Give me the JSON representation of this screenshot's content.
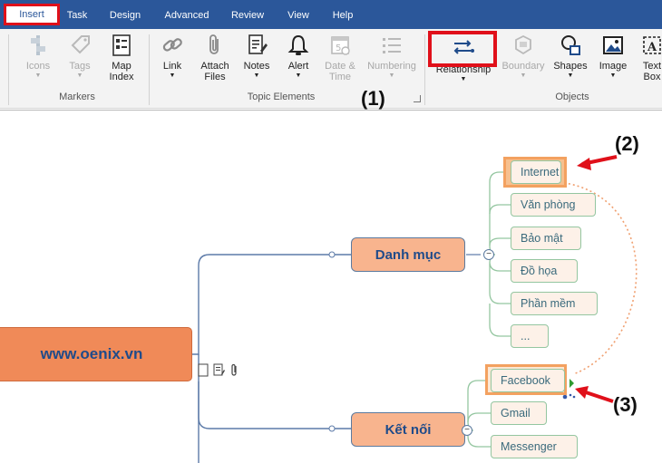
{
  "tabs": [
    {
      "label": "Insert",
      "active": true
    },
    {
      "label": "Task"
    },
    {
      "label": "Design"
    },
    {
      "label": "Advanced"
    },
    {
      "label": "Review"
    },
    {
      "label": "View"
    },
    {
      "label": "Help"
    }
  ],
  "ribbon": {
    "markers": {
      "label": "Markers",
      "buttons": [
        {
          "label": "Icons",
          "icon": "icons-icon",
          "enabled": false
        },
        {
          "label": "Tags",
          "icon": "tag-icon",
          "enabled": false
        },
        {
          "label": "Map\nIndex",
          "icon": "map-index-icon",
          "enabled": true
        }
      ]
    },
    "topic_elements": {
      "label": "Topic Elements",
      "buttons": [
        {
          "label": "Link",
          "icon": "link-icon",
          "enabled": true
        },
        {
          "label": "Attach\nFiles",
          "icon": "paperclip-icon",
          "enabled": true
        },
        {
          "label": "Notes",
          "icon": "notes-icon",
          "enabled": true
        },
        {
          "label": "Alert",
          "icon": "bell-icon",
          "enabled": true
        },
        {
          "label": "Date &\nTime",
          "icon": "calendar-icon",
          "enabled": false
        },
        {
          "label": "Numbering",
          "icon": "numbering-icon",
          "enabled": false
        }
      ]
    },
    "objects": {
      "label": "Objects",
      "buttons": [
        {
          "label": "Relationship",
          "icon": "relationship-icon",
          "enabled": true
        },
        {
          "label": "Boundary",
          "icon": "boundary-icon",
          "enabled": false
        },
        {
          "label": "Shapes",
          "icon": "shapes-icon",
          "enabled": true
        },
        {
          "label": "Image",
          "icon": "image-icon",
          "enabled": true
        },
        {
          "label": "Text\nBox",
          "icon": "textbox-icon",
          "enabled": true
        }
      ]
    }
  },
  "mindmap": {
    "root": "www.oenix.vn",
    "branches": [
      {
        "label": "Danh mục",
        "children": [
          "Internet",
          "Văn phòng",
          "Bảo mật",
          "Đồ họa",
          "Phần mềm",
          "..."
        ]
      },
      {
        "label": "Kết nối",
        "children": [
          "Facebook",
          "Gmail",
          "Messenger"
        ]
      }
    ]
  },
  "annotations": [
    "(1)",
    "(2)",
    "(3)"
  ],
  "colors": {
    "tab_bar": "#2b579a",
    "highlight_red": "#e0101a",
    "root_fill": "#f08a58",
    "branch_fill": "#f8b48e",
    "relationship_line": "#f0a070"
  }
}
